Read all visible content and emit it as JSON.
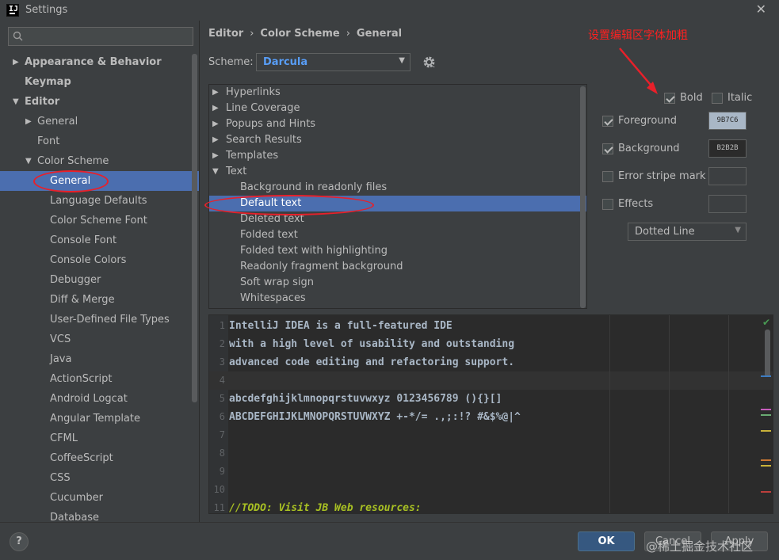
{
  "window": {
    "title": "Settings"
  },
  "search": {
    "placeholder": ""
  },
  "tree": {
    "items": [
      {
        "label": "Appearance & Behavior",
        "indent": 0,
        "arrow": "right",
        "bold": true
      },
      {
        "label": "Keymap",
        "indent": 0,
        "arrow": "",
        "bold": true
      },
      {
        "label": "Editor",
        "indent": 0,
        "arrow": "down",
        "bold": true
      },
      {
        "label": "General",
        "indent": 1,
        "arrow": "right",
        "bold": false
      },
      {
        "label": "Font",
        "indent": 1,
        "arrow": "",
        "bold": false
      },
      {
        "label": "Color Scheme",
        "indent": 1,
        "arrow": "down",
        "bold": false
      },
      {
        "label": "General",
        "indent": 2,
        "arrow": "",
        "bold": false,
        "selected": true
      },
      {
        "label": "Language Defaults",
        "indent": 2,
        "arrow": "",
        "bold": false
      },
      {
        "label": "Color Scheme Font",
        "indent": 2,
        "arrow": "",
        "bold": false
      },
      {
        "label": "Console Font",
        "indent": 2,
        "arrow": "",
        "bold": false
      },
      {
        "label": "Console Colors",
        "indent": 2,
        "arrow": "",
        "bold": false
      },
      {
        "label": "Debugger",
        "indent": 2,
        "arrow": "",
        "bold": false
      },
      {
        "label": "Diff & Merge",
        "indent": 2,
        "arrow": "",
        "bold": false
      },
      {
        "label": "User-Defined File Types",
        "indent": 2,
        "arrow": "",
        "bold": false
      },
      {
        "label": "VCS",
        "indent": 2,
        "arrow": "",
        "bold": false
      },
      {
        "label": "Java",
        "indent": 2,
        "arrow": "",
        "bold": false
      },
      {
        "label": "ActionScript",
        "indent": 2,
        "arrow": "",
        "bold": false
      },
      {
        "label": "Android Logcat",
        "indent": 2,
        "arrow": "",
        "bold": false
      },
      {
        "label": "Angular Template",
        "indent": 2,
        "arrow": "",
        "bold": false
      },
      {
        "label": "CFML",
        "indent": 2,
        "arrow": "",
        "bold": false
      },
      {
        "label": "CoffeeScript",
        "indent": 2,
        "arrow": "",
        "bold": false
      },
      {
        "label": "CSS",
        "indent": 2,
        "arrow": "",
        "bold": false
      },
      {
        "label": "Cucumber",
        "indent": 2,
        "arrow": "",
        "bold": false
      },
      {
        "label": "Database",
        "indent": 2,
        "arrow": "",
        "bold": false
      }
    ]
  },
  "breadcrumb": {
    "part1": "Editor",
    "part2": "Color Scheme",
    "part3": "General",
    "sep": "›"
  },
  "scheme": {
    "label": "Scheme:",
    "value": "Darcula"
  },
  "annotation": {
    "text": "设置编辑区字体加粗"
  },
  "categories": {
    "items": [
      {
        "label": "Hyperlinks",
        "arrow": "right",
        "indent": 0
      },
      {
        "label": "Line Coverage",
        "arrow": "right",
        "indent": 0
      },
      {
        "label": "Popups and Hints",
        "arrow": "right",
        "indent": 0
      },
      {
        "label": "Search Results",
        "arrow": "right",
        "indent": 0
      },
      {
        "label": "Templates",
        "arrow": "right",
        "indent": 0
      },
      {
        "label": "Text",
        "arrow": "down",
        "indent": 0
      },
      {
        "label": "Background in readonly files",
        "arrow": "",
        "indent": 1
      },
      {
        "label": "Default text",
        "arrow": "",
        "indent": 1,
        "selected": true
      },
      {
        "label": "Deleted text",
        "arrow": "",
        "indent": 1
      },
      {
        "label": "Folded text",
        "arrow": "",
        "indent": 1
      },
      {
        "label": "Folded text with highlighting",
        "arrow": "",
        "indent": 1
      },
      {
        "label": "Readonly fragment background",
        "arrow": "",
        "indent": 1
      },
      {
        "label": "Soft wrap sign",
        "arrow": "",
        "indent": 1
      },
      {
        "label": "Whitespaces",
        "arrow": "",
        "indent": 1
      }
    ]
  },
  "props": {
    "bold": {
      "label": "Bold",
      "checked": true
    },
    "italic": {
      "label": "Italic",
      "checked": false
    },
    "foreground": {
      "label": "Foreground",
      "checked": true,
      "value": "9B7C6",
      "color": "#a9b7c6"
    },
    "background": {
      "label": "Background",
      "checked": true,
      "value": "B2B2B",
      "color": "#2b2b2b"
    },
    "error_stripe": {
      "label": "Error stripe mark",
      "checked": false
    },
    "effects": {
      "label": "Effects",
      "checked": false
    },
    "effects_type": "Dotted Line"
  },
  "editor": {
    "lines": [
      {
        "n": "1",
        "text": "IntelliJ IDEA is a full-featured IDE"
      },
      {
        "n": "2",
        "text": "with a high level of usability and outstanding"
      },
      {
        "n": "3",
        "text": "advanced code editing and refactoring support."
      },
      {
        "n": "4",
        "text": ""
      },
      {
        "n": "5",
        "text": "abcdefghijklmnopqrstuvwxyz 0123456789 (){}[]"
      },
      {
        "n": "6",
        "text": "ABCDEFGHIJKLMNOPQRSTUVWXYZ +-*/= .,;:!? #&$%@|^"
      },
      {
        "n": "7",
        "text": ""
      },
      {
        "n": "8",
        "text": ""
      },
      {
        "n": "9",
        "text": ""
      },
      {
        "n": "10",
        "text": ""
      },
      {
        "n": "11",
        "text": "//TODO: Visit JB Web resources:"
      }
    ]
  },
  "buttons": {
    "help": "?",
    "ok": "OK",
    "cancel": "Cancel",
    "apply": "Apply"
  },
  "watermark": {
    "text": "@稀土掘金技术社区"
  },
  "colors": {
    "selection": "#4b6eaf",
    "accent": "#589df6",
    "annotation_red": "#e8202a"
  }
}
